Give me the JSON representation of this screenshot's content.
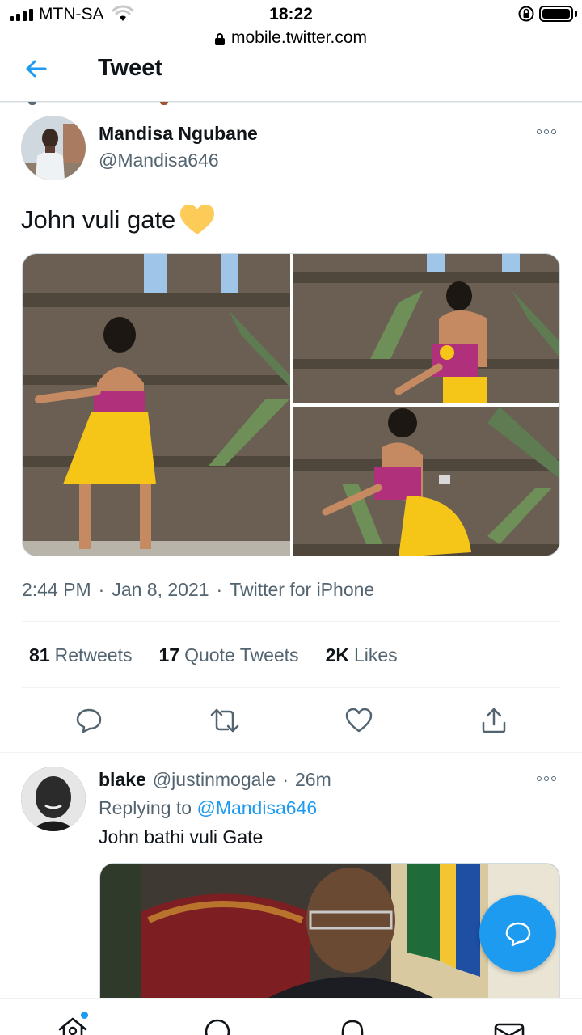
{
  "status_bar": {
    "carrier": "MTN-SA",
    "time": "18:22",
    "url": "mobile.twitter.com"
  },
  "header": {
    "back_icon": "arrow-left-icon",
    "title": "Tweet"
  },
  "tweet": {
    "author_name": "Mandisa Ngubane",
    "author_handle": "@Mandisa646",
    "text": "John vuli gate",
    "emoji": "yellow-heart",
    "time": "2:44 PM",
    "date": "Jan 8, 2021",
    "source": "Twitter for iPhone",
    "separator": "·",
    "stats": {
      "retweets_count": "81",
      "retweets_label": "Retweets",
      "quotes_count": "17",
      "quotes_label": "Quote Tweets",
      "likes_count": "2K",
      "likes_label": "Likes"
    },
    "actions": [
      "reply-icon",
      "retweet-icon",
      "like-icon",
      "share-icon"
    ]
  },
  "reply": {
    "name": "blake",
    "handle": "@justinmogale",
    "separator": "·",
    "age": "26m",
    "replying_prefix": "Replying to",
    "replying_handle": "@Mandisa646",
    "text": "John bathi vuli Gate"
  },
  "colors": {
    "accent": "#1d9bf0",
    "text_primary": "#0f1419",
    "text_secondary": "#536471"
  },
  "bottom_nav": [
    "home-icon",
    "search-icon",
    "notifications-icon",
    "messages-icon"
  ]
}
